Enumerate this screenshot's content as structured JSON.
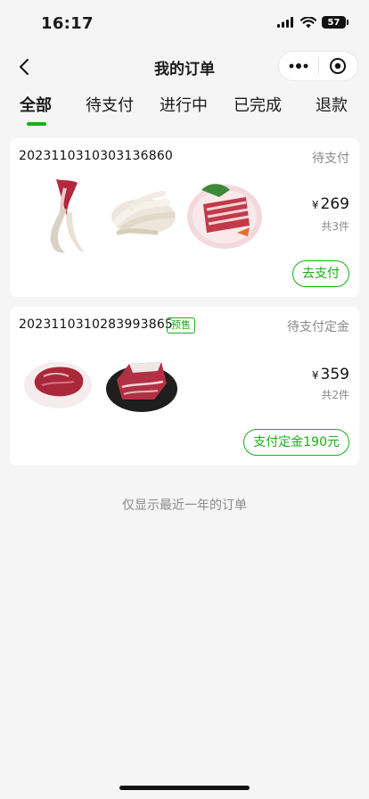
{
  "status_bar": {
    "time": "16:17",
    "battery": "57",
    "icons": [
      "signal-icon",
      "wifi-icon",
      "battery-icon"
    ]
  },
  "nav": {
    "title": "我的订单",
    "icons": [
      "back-icon",
      "more-icon",
      "close-capsule-icon"
    ]
  },
  "tabs": [
    {
      "label": "全部",
      "active": true
    },
    {
      "label": "待支付",
      "active": false
    },
    {
      "label": "进行中",
      "active": false
    },
    {
      "label": "已完成",
      "active": false
    },
    {
      "label": "退款",
      "active": false
    }
  ],
  "orders": [
    {
      "order_no": "2023110310303136860",
      "status": "待支付",
      "badge": "",
      "products": [
        "beef-tail",
        "chicken-feet",
        "lamb-ribs-platter"
      ],
      "currency": "¥",
      "price": "269",
      "count": "共3件",
      "action": "去支付"
    },
    {
      "order_no": "2023110310283993865",
      "status": "待支付定金",
      "badge": "预售",
      "products": [
        "beef-cut",
        "brisket-on-slate"
      ],
      "currency": "¥",
      "price": "359",
      "count": "共2件",
      "action": "支付定金190元"
    }
  ],
  "footer_note": "仅显示最近一年的订单",
  "colors": {
    "accent": "#1aad19",
    "background": "#f5f5f5",
    "muted_text": "#8a8a8a"
  }
}
